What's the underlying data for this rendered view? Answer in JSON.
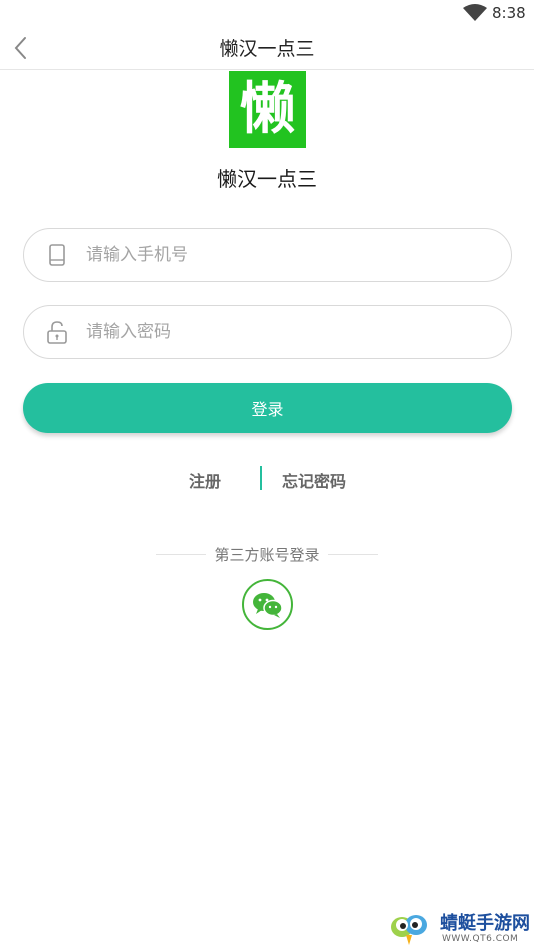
{
  "status_bar": {
    "time": "8:38",
    "wifi_icon": "wifi-icon"
  },
  "app_bar": {
    "back_icon": "chevron-left-icon",
    "title": "懒汉一点三"
  },
  "logo": {
    "glyph": "懒",
    "name": "懒汉一点三",
    "color": "#22c320"
  },
  "form": {
    "phone_placeholder": "请输入手机号",
    "phone_icon": "phone-icon",
    "password_placeholder": "请输入密码",
    "password_icon": "lock-icon",
    "login_label": "登录",
    "accent_color": "#24bf9e"
  },
  "links": {
    "register": "注册",
    "forgot_password": "忘记密码"
  },
  "third_party": {
    "label": "第三方账号登录",
    "wechat_icon": "wechat-icon"
  },
  "watermark": {
    "name": "蜻蜓手游网",
    "url": "WWW.QT6.COM"
  }
}
